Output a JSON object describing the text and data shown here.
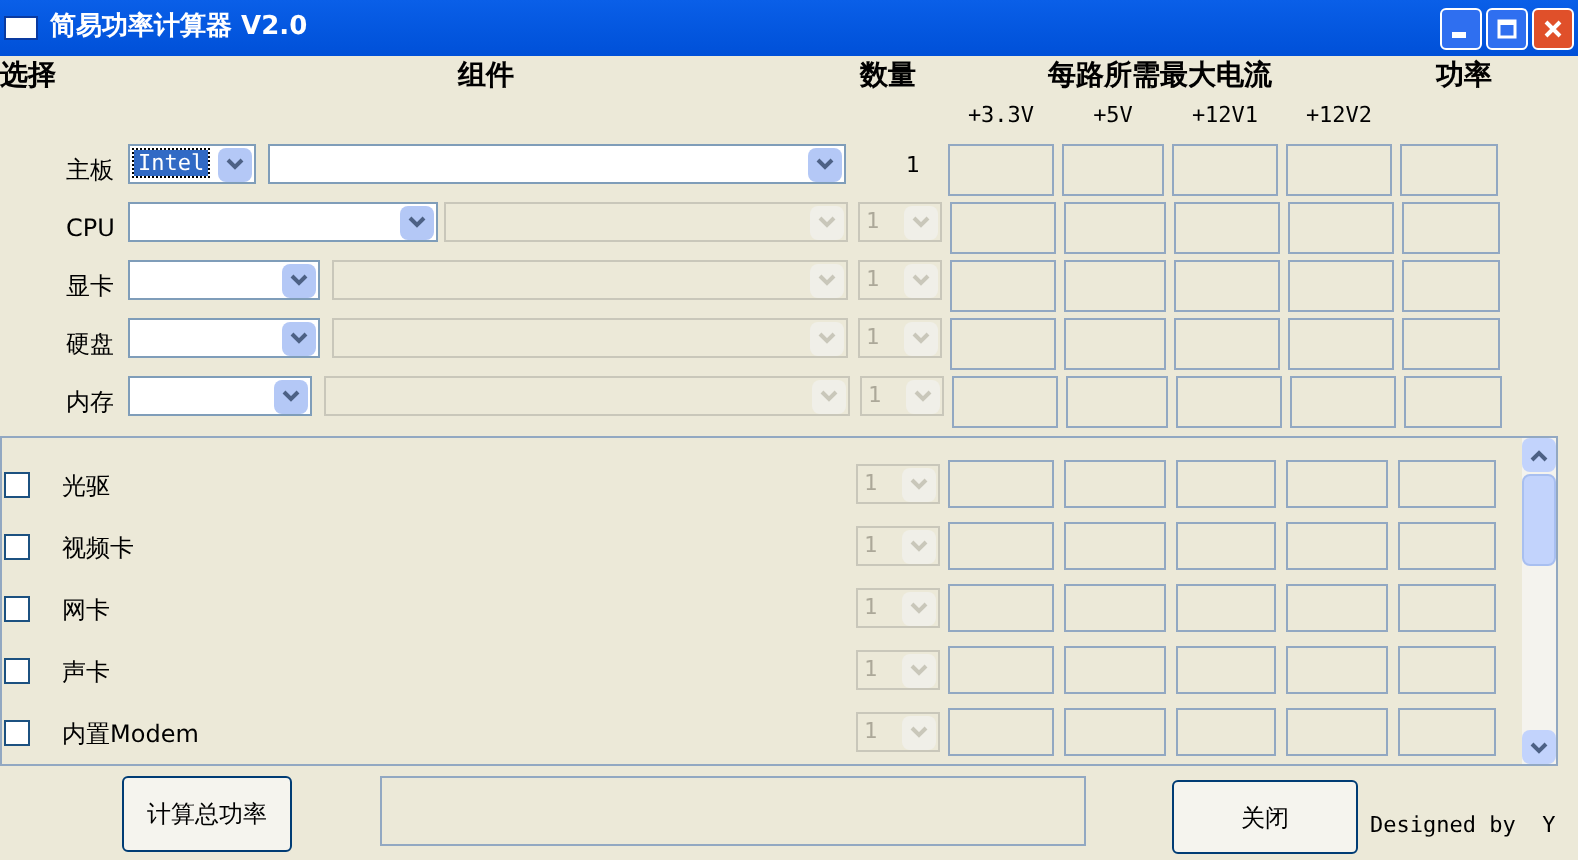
{
  "window": {
    "title": "简易功率计算器 V2.0"
  },
  "header": {
    "select": "选择",
    "component": "组件",
    "quantity": "数量",
    "current": "每路所需最大电流",
    "power": "功率"
  },
  "rails": [
    "+3.3V",
    "+5V",
    "+12V1",
    "+12V2"
  ],
  "main_rows": [
    {
      "label": "主板",
      "brand": {
        "value": "Intel",
        "focused": true
      },
      "model": {
        "disabled": false
      },
      "quantity": {
        "kind": "text",
        "value": "1"
      }
    },
    {
      "label": "CPU",
      "model": {
        "disabled": true
      },
      "quantity": {
        "kind": "combo",
        "value": "1"
      }
    },
    {
      "label": "显卡",
      "model": {
        "disabled": true
      },
      "quantity": {
        "kind": "combo",
        "value": "1"
      }
    },
    {
      "label": "硬盘",
      "model": {
        "disabled": true
      },
      "quantity": {
        "kind": "combo",
        "value": "1"
      }
    },
    {
      "label": "内存",
      "model": {
        "disabled": true
      },
      "quantity": {
        "kind": "combo",
        "value": "1"
      }
    }
  ],
  "optional_rows": [
    {
      "label": "光驱",
      "checked": false,
      "quantity": "1"
    },
    {
      "label": "视频卡",
      "checked": false,
      "quantity": "1"
    },
    {
      "label": "网卡",
      "checked": false,
      "quantity": "1"
    },
    {
      "label": "声卡",
      "checked": false,
      "quantity": "1"
    },
    {
      "label": "内置Modem",
      "checked": false,
      "quantity": "1"
    }
  ],
  "buttons": {
    "calculate": "计算总功率",
    "close": "关闭"
  },
  "footer": "Designed by  Y"
}
